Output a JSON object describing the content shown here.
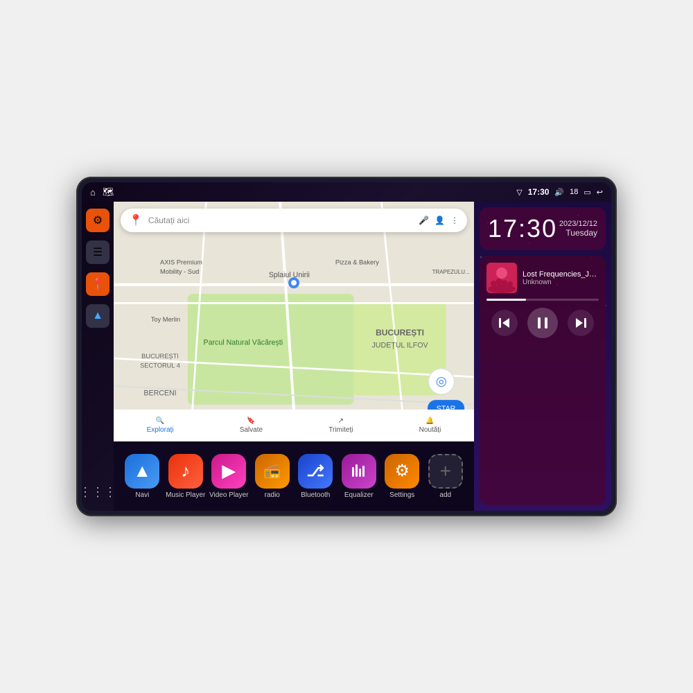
{
  "device": {
    "status_bar": {
      "left_icons": [
        "home",
        "maps"
      ],
      "time": "17:30",
      "signal": "▼▲",
      "volume": "🔊",
      "battery_level": "18",
      "battery": "🔋",
      "back": "↩"
    },
    "clock": {
      "time": "17:30",
      "date": "2023/12/12",
      "day": "Tuesday"
    },
    "music": {
      "track_name": "Lost Frequencies_Janie...",
      "artist": "Unknown",
      "progress": 35
    },
    "map": {
      "search_placeholder": "Căutați aici",
      "nav_items": [
        "Explorați",
        "Salvate",
        "Trimiteți",
        "Noutăți"
      ]
    },
    "apps": [
      {
        "id": "navi",
        "label": "Navi",
        "icon_class": "icon-navi",
        "icon": "▲"
      },
      {
        "id": "music-player",
        "label": "Music Player",
        "icon_class": "icon-music",
        "icon": "♪"
      },
      {
        "id": "video-player",
        "label": "Video Player",
        "icon_class": "icon-video",
        "icon": "▶"
      },
      {
        "id": "radio",
        "label": "radio",
        "icon_class": "icon-radio",
        "icon": "📻"
      },
      {
        "id": "bluetooth",
        "label": "Bluetooth",
        "icon_class": "icon-bt",
        "icon": "₿"
      },
      {
        "id": "equalizer",
        "label": "Equalizer",
        "icon_class": "icon-eq",
        "icon": "🎛"
      },
      {
        "id": "settings",
        "label": "Settings",
        "icon_class": "icon-settings",
        "icon": "⚙"
      },
      {
        "id": "add",
        "label": "add",
        "icon_class": "icon-add",
        "icon": "+"
      }
    ],
    "sidebar": [
      {
        "id": "settings",
        "icon": "⚙",
        "style": "orange"
      },
      {
        "id": "files",
        "icon": "☰",
        "style": "dark"
      },
      {
        "id": "maps",
        "icon": "📍",
        "style": "orange"
      },
      {
        "id": "navi",
        "icon": "▲",
        "style": "dark"
      }
    ]
  }
}
